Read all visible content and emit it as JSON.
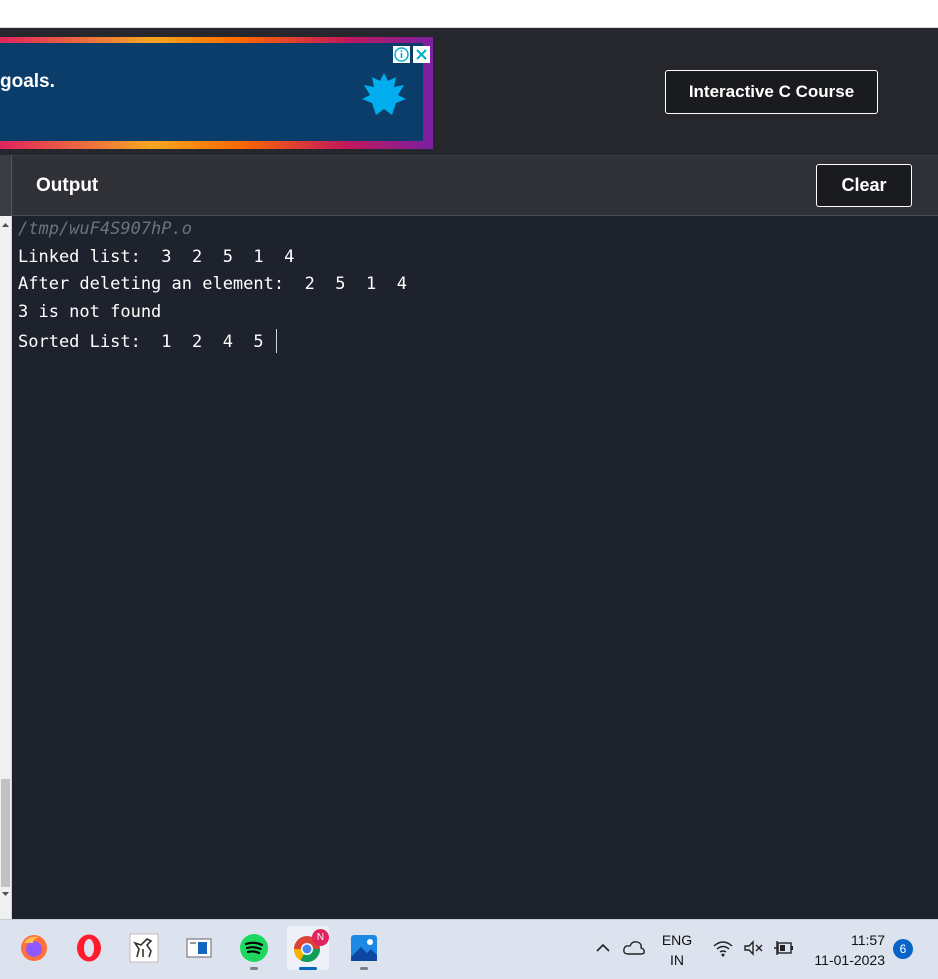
{
  "ad": {
    "text": "goals."
  },
  "header": {
    "course_button": "Interactive C Course"
  },
  "output": {
    "title": "Output",
    "clear_button": "Clear"
  },
  "console": {
    "lines": [
      "/tmp/wuF4S907hP.o",
      "Linked list:  3  2  5  1  4",
      "After deleting an element:  2  5  1  4",
      "3 is not found",
      "Sorted List:  1  2  4  5 "
    ]
  },
  "taskbar": {
    "apps": [
      "firefox-icon",
      "opera-icon",
      "dinosaur-app-icon",
      "reader-app-icon",
      "spotify-icon",
      "chrome-icon",
      "photos-icon"
    ],
    "chrome_badge": "N",
    "language": {
      "top": "ENG",
      "bottom": "IN"
    },
    "time": "11:57",
    "date": "11-01-2023",
    "notifications": "6"
  }
}
